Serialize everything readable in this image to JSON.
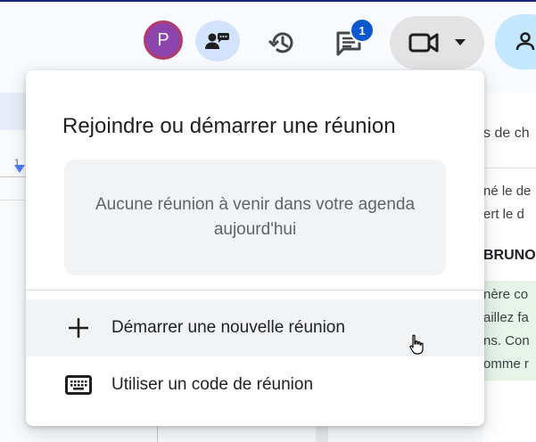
{
  "toolbar": {
    "avatar_initial": "P",
    "comments_badge": "1",
    "icons": {
      "present": "present-to-chat-icon",
      "history": "history-icon",
      "comments": "comments-icon",
      "meet": "video-camera-icon",
      "dropdown": "caret-down-icon",
      "share": "share-people-icon"
    },
    "colors": {
      "accent": "#0b57d0",
      "avatar": "#8e44ad",
      "share": "#c2e7ff"
    }
  },
  "ruler": {
    "tick_label": "1"
  },
  "side_panel": {
    "header": "s de ch",
    "lines": [
      "né le de",
      "ert le d"
    ],
    "name": "BRUNO",
    "green_lines": [
      "nère co",
      "aillez fa",
      "ns. Con",
      "omme r"
    ]
  },
  "meet_popup": {
    "title": "Rejoindre ou démarrer une réunion",
    "empty_state": "Aucune réunion à venir dans votre agenda aujourd'hui",
    "items": [
      {
        "label": "Démarrer une nouvelle réunion",
        "icon": "plus-icon"
      },
      {
        "label": "Utiliser un code de réunion",
        "icon": "keyboard-icon"
      }
    ]
  }
}
